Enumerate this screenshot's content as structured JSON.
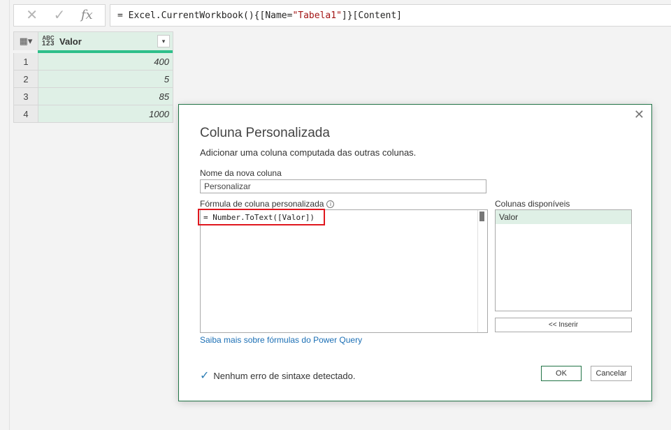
{
  "formula_bar": {
    "cancel_icon": "✕",
    "confirm_icon": "✓",
    "fx_label": "fx",
    "formula_prefix": "= Excel.CurrentWorkbook(){[Name=",
    "formula_string": "\"Tabela1\"",
    "formula_suffix": "]}[Content]"
  },
  "grid": {
    "corner_icon": "▦▾",
    "column": {
      "type_abc": "ABC",
      "type_num": "123",
      "name": "Valor",
      "dropdown": "▾"
    },
    "rows": [
      {
        "index": "1",
        "value": "400"
      },
      {
        "index": "2",
        "value": "5"
      },
      {
        "index": "3",
        "value": "85"
      },
      {
        "index": "4",
        "value": "1000"
      }
    ]
  },
  "dialog": {
    "close": "✕",
    "title": "Coluna Personalizada",
    "subtitle": "Adicionar uma coluna computada das outras colunas.",
    "name_label": "Nome da nova coluna",
    "name_value": "Personalizar",
    "formula_label": "Fórmula de coluna personalizada",
    "info_icon": "i",
    "formula_code": "= Number.ToText([Valor])",
    "available_label": "Colunas disponíveis",
    "available_columns": [
      "Valor"
    ],
    "insert_button": "<< Inserir",
    "learn_link": "Saiba mais sobre fórmulas do Power Query",
    "status_icon": "✓",
    "status_text": "Nenhum erro de sintaxe detectado.",
    "ok_button": "OK",
    "cancel_button": "Cancelar"
  },
  "colors": {
    "accent": "#217346",
    "highlight_border": "#e0171e",
    "link": "#1b6fb5",
    "column_fill": "#dff0e6",
    "column_underline": "#2ebf8a"
  }
}
